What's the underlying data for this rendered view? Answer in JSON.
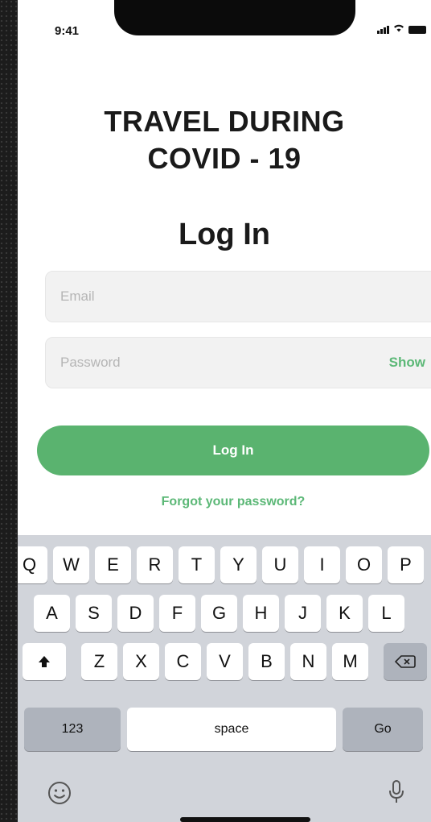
{
  "status_bar": {
    "time": "9:41"
  },
  "app": {
    "title_line1": "TRAVEL DURING",
    "title_line2": "COVID - 19",
    "subtitle": "Log In"
  },
  "form": {
    "email_placeholder": "Email",
    "password_placeholder": "Password",
    "show_label": "Show",
    "submit_label": "Log In",
    "forgot_label": "Forgot your password?"
  },
  "keyboard": {
    "row1": [
      "Q",
      "W",
      "E",
      "R",
      "T",
      "Y",
      "U",
      "I",
      "O",
      "P"
    ],
    "row2": [
      "A",
      "S",
      "D",
      "F",
      "G",
      "H",
      "J",
      "K",
      "L"
    ],
    "row3": [
      "Z",
      "X",
      "C",
      "V",
      "B",
      "N",
      "M"
    ],
    "numbers_key": "123",
    "space_key": "space",
    "go_key": "Go",
    "shift_icon": "shift-icon",
    "delete_icon": "delete-icon",
    "emoji_icon": "emoji-icon",
    "mic_icon": "microphone-icon"
  },
  "colors": {
    "accent": "#5ab36f",
    "field_bg": "#f2f2f2",
    "keyboard_bg": "#d1d4da"
  }
}
